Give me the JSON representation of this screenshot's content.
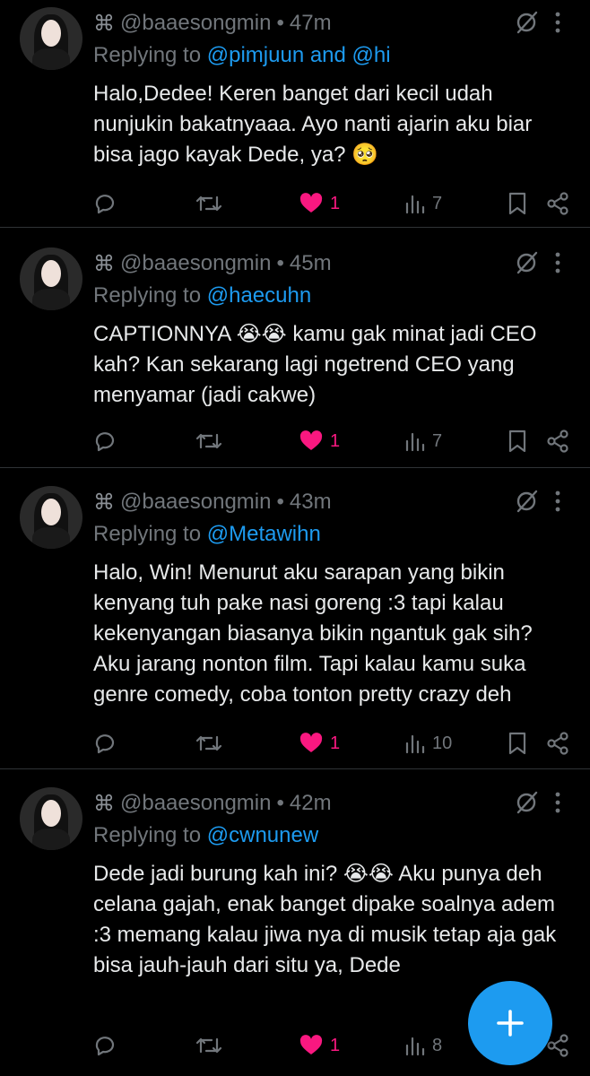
{
  "tweets": [
    {
      "cmd_glyph": "⌘",
      "handle": "@baaesongmin",
      "sep": "•",
      "time": "47m",
      "replying_prefix": "Replying to ",
      "replying_mentions": "@pimjuun and @hi",
      "text": "Halo,Dedee! Keren banget dari kecil udah nunjukin bakatnyaaa. Ayo nanti ajarin aku biar bisa jago kayak Dede, ya? 🥺",
      "likes": "1",
      "views": "7"
    },
    {
      "cmd_glyph": "⌘",
      "handle": "@baaesongmin",
      "sep": "•",
      "time": "45m",
      "replying_prefix": "Replying to ",
      "replying_mentions": "@haecuhn",
      "text": "CAPTIONNYA 😭😭 kamu gak minat jadi CEO kah? Kan sekarang lagi ngetrend CEO yang menyamar (jadi cakwe)",
      "likes": "1",
      "views": "7"
    },
    {
      "cmd_glyph": "⌘",
      "handle": "@baaesongmin",
      "sep": "•",
      "time": "43m",
      "replying_prefix": "Replying to ",
      "replying_mentions": "@Metawihn",
      "text": "Halo, Win! Menurut aku sarapan yang bikin kenyang tuh pake nasi goreng :3 tapi kalau kekenyangan biasanya bikin ngantuk gak sih? Aku jarang nonton film. Tapi kalau kamu suka genre comedy, coba tonton pretty crazy deh",
      "likes": "1",
      "views": "10"
    },
    {
      "cmd_glyph": "⌘",
      "handle": "@baaesongmin",
      "sep": "•",
      "time": "42m",
      "replying_prefix": "Replying to ",
      "replying_mentions": "@cwnunew",
      "text": "Dede jadi burung kah ini? 😭😭 Aku punya deh celana gajah, enak banget dipake soalnya adem :3 memang kalau jiwa nya di musik tetap aja gak bisa jauh-jauh dari situ ya, Dede",
      "likes": "1",
      "views": "8"
    }
  ],
  "icons": {
    "reply": "reply-icon",
    "retweet": "retweet-icon",
    "like": "heart-filled-icon",
    "views": "views-icon",
    "bookmark": "bookmark-icon",
    "share": "share-icon",
    "mute": "muted-conversation-icon",
    "more": "more-dots-icon",
    "compose": "plus-icon"
  },
  "colors": {
    "background": "#000000",
    "text": "#e7e9ea",
    "muted": "#71767b",
    "link": "#1d9bf0",
    "like": "#f91880",
    "fab": "#1d9bf0"
  }
}
